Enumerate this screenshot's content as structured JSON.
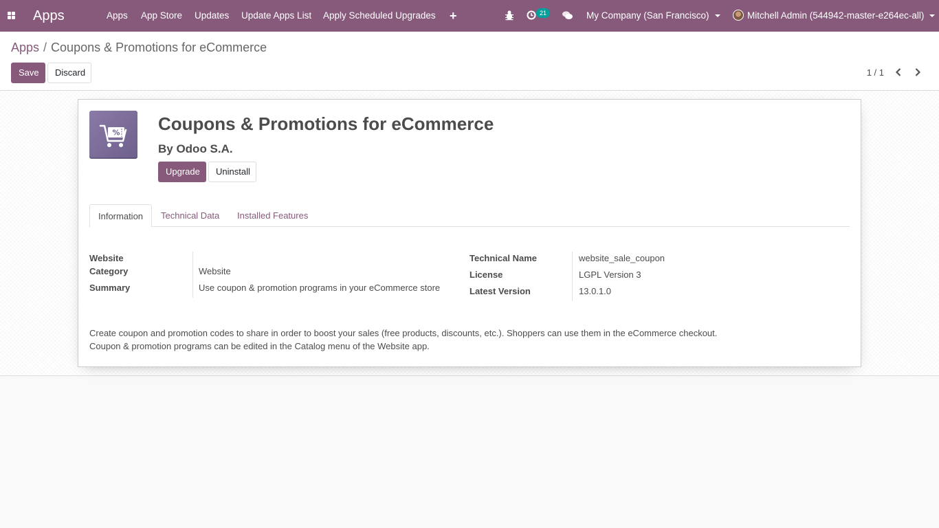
{
  "navbar": {
    "brand": "Apps",
    "menu": [
      "Apps",
      "App Store",
      "Updates",
      "Update Apps List",
      "Apply Scheduled Upgrades"
    ],
    "plus_glyph": "+",
    "activity_count": "21",
    "company": "My Company (San Francisco)",
    "user": "Mitchell Admin (544942-master-e264ec-all)",
    "icons": [
      "apps-grid-icon",
      "bug-icon",
      "activity-clock-icon",
      "chat-icon"
    ]
  },
  "control_panel": {
    "breadcrumb_root": "Apps",
    "breadcrumb_separator": "/",
    "breadcrumb_current": "Coupons & Promotions for eCommerce",
    "save_label": "Save",
    "discard_label": "Discard",
    "pager": "1 / 1"
  },
  "module": {
    "title": "Coupons & Promotions for eCommerce",
    "author": "By Odoo S.A.",
    "upgrade_label": "Upgrade",
    "uninstall_label": "Uninstall",
    "tabs": [
      "Information",
      "Technical Data",
      "Installed Features"
    ],
    "left_fields": [
      {
        "label": "Website",
        "value": ""
      },
      {
        "label": "Category",
        "value": "Website"
      },
      {
        "label": "Summary",
        "value": "Use coupon & promotion programs in your eCommerce store"
      }
    ],
    "right_fields": [
      {
        "label": "Technical Name",
        "value": "website_sale_coupon"
      },
      {
        "label": "License",
        "value": "LGPL Version 3"
      },
      {
        "label": "Latest Version",
        "value": "13.0.1.0"
      }
    ],
    "description": [
      "Create coupon and promotion codes to share in order to boost your sales (free products, discounts, etc.). Shoppers can use them in the eCommerce checkout.",
      "Coupon & promotion programs can be edited in the Catalog menu of the Website app."
    ]
  },
  "colors": {
    "primary": "#875a7b",
    "badge": "#00a09d"
  }
}
